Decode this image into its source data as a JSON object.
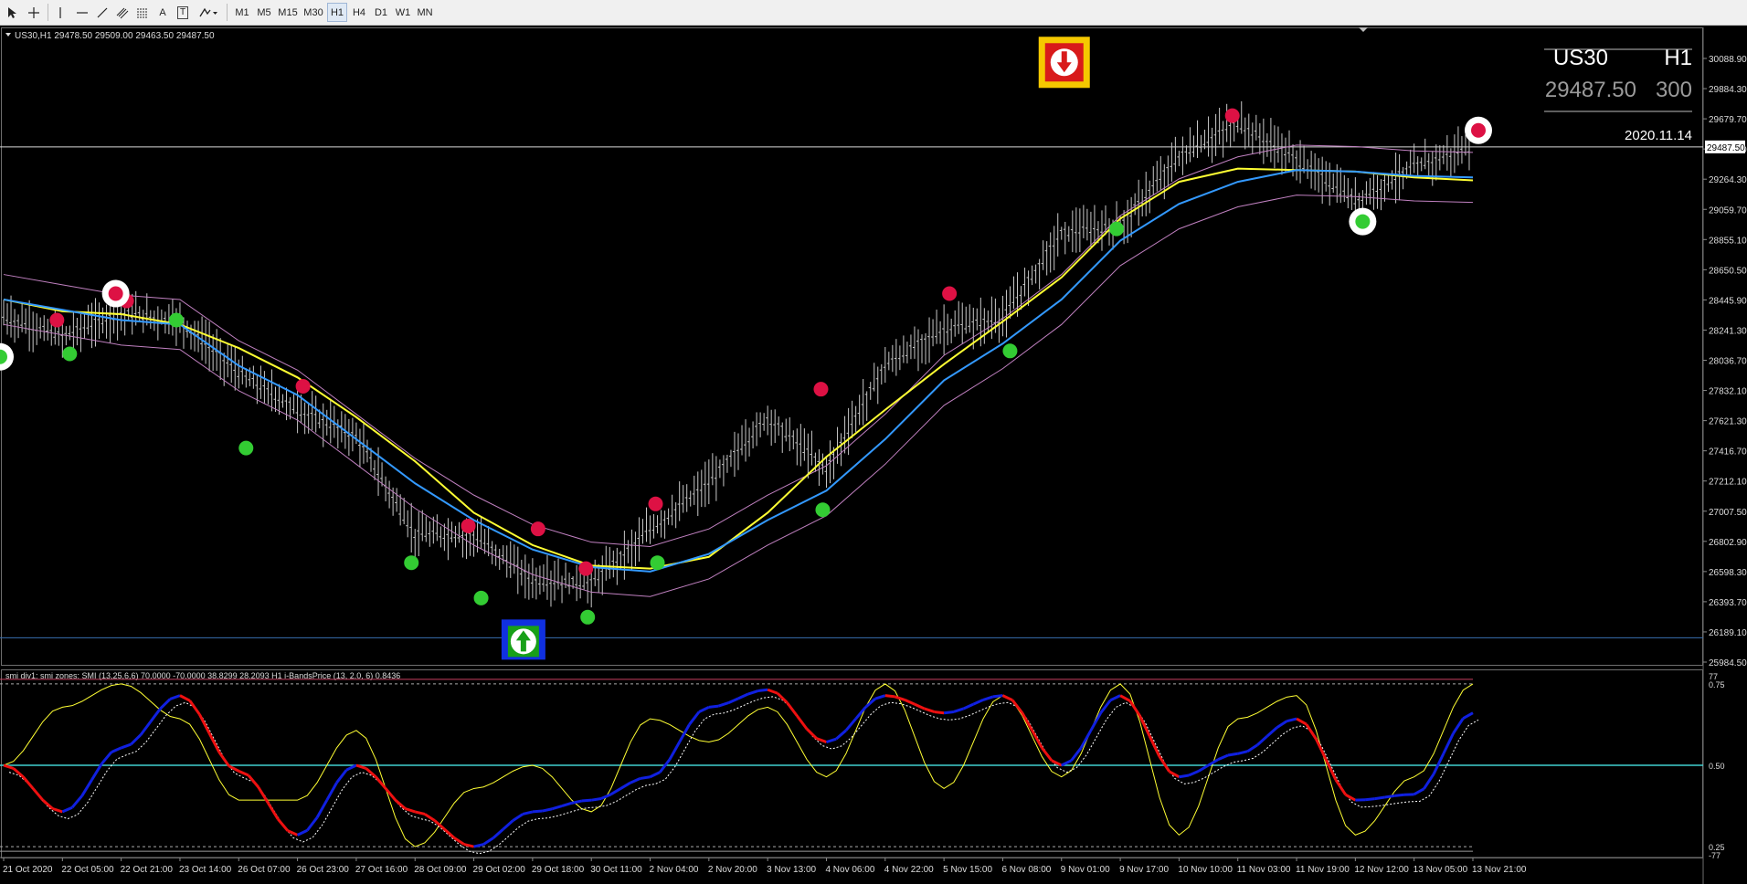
{
  "toolbar": {
    "icons": [
      "cursor-icon",
      "crosshair-icon",
      "vertical-line-icon",
      "horizontal-line-icon",
      "trendline-icon",
      "channel-icon",
      "fibonacci-icon",
      "text-icon",
      "label-icon",
      "shapes-dropdown-icon"
    ],
    "text_tool": "A",
    "label_tool": "T",
    "timeframes": [
      "M1",
      "M5",
      "M15",
      "M30",
      "H1",
      "H4",
      "D1",
      "W1",
      "MN"
    ],
    "active_timeframe": "H1"
  },
  "chart": {
    "header": "US30,H1  29478.50 29509.00 29463.50 29487.50",
    "symbol": "US30",
    "timeframe": "H1",
    "price": "29487.50",
    "spread": "300",
    "date": "2020.11.14",
    "current_price_label": "29487.50",
    "price_ticks": [
      "30088.90",
      "29884.30",
      "29679.70",
      "29474.20",
      "29264.30",
      "29059.70",
      "28855.10",
      "28650.50",
      "28445.90",
      "28241.30",
      "28036.70",
      "27832.10",
      "27621.30",
      "27416.70",
      "27212.10",
      "27007.50",
      "26802.90",
      "26598.30",
      "26393.70",
      "26189.10",
      "25984.50"
    ],
    "colors": {
      "ma_yellow": "#ffff33",
      "ma_blue": "#3399ff",
      "bands": "#c080c0",
      "buy": "#33cc33",
      "sell": "#dd1144",
      "candles": "#c8c8c8"
    }
  },
  "chart_data": [
    {
      "type": "line",
      "title": "US30,H1",
      "ylim": [
        25984.5,
        30088.9
      ],
      "x": [
        "21 Oct 2020",
        "22 Oct 05:00",
        "22 Oct 21:00",
        "23 Oct 14:00",
        "26 Oct 07:00",
        "26 Oct 23:00",
        "27 Oct 16:00",
        "28 Oct 09:00",
        "29 Oct 02:00",
        "29 Oct 18:00",
        "30 Oct 11:00",
        "2 Nov 04:00",
        "2 Nov 20:00",
        "3 Nov 13:00",
        "4 Nov 06:00",
        "4 Nov 22:00",
        "5 Nov 15:00",
        "6 Nov 08:00",
        "9 Nov 01:00",
        "9 Nov 17:00",
        "10 Nov 10:00",
        "11 Nov 03:00",
        "11 Nov 19:00",
        "12 Nov 12:00",
        "13 Nov 05:00",
        "13 Nov 21:00"
      ],
      "series": [
        {
          "values": [
            28330,
            28200,
            28360,
            28300,
            27950,
            27700,
            27520,
            26850,
            26850,
            26540,
            26520,
            26880,
            27200,
            27650,
            27300,
            28000,
            28250,
            28320,
            28900,
            28950,
            29420,
            29650,
            29400,
            29120,
            29350,
            29487.5
          ]
        },
        {
          "values": [
            28450,
            28370,
            28350,
            28280,
            28120,
            27920,
            27650,
            27350,
            27000,
            26780,
            26640,
            26620,
            26700,
            27000,
            27380,
            27700,
            28010,
            28300,
            28600,
            29000,
            29250,
            29340,
            29330,
            29320,
            29280,
            29260
          ]
        },
        {
          "values": [
            28450,
            28380,
            28310,
            28280,
            28000,
            27800,
            27500,
            27200,
            26950,
            26750,
            26630,
            26600,
            26720,
            26950,
            27150,
            27500,
            27900,
            28150,
            28450,
            28850,
            29100,
            29250,
            29330,
            29320,
            29290,
            29280
          ]
        }
      ],
      "signals_buy": [
        {
          "x": "21 Oct 2020",
          "y": 28060
        },
        {
          "x": "22 Oct 05:00",
          "y": 28080
        },
        {
          "x": "23 Oct 14:00",
          "y": 28310
        },
        {
          "x": "26 Oct 07:00",
          "y": 27440
        },
        {
          "x": "28 Oct 09:00",
          "y": 26660
        },
        {
          "x": "29 Oct 02:00",
          "y": 26420
        },
        {
          "x": "30 Oct 11:00",
          "y": 26290
        },
        {
          "x": "2 Nov 04:00",
          "y": 26660
        },
        {
          "x": "4 Nov 06:00",
          "y": 27020
        },
        {
          "x": "6 Nov 08:00",
          "y": 28100
        },
        {
          "x": "9 Nov 17:00",
          "y": 28930
        },
        {
          "x": "12 Nov 12:00",
          "y": 28980
        }
      ],
      "signals_sell": [
        {
          "x": "22 Oct 05:00",
          "y": 28310
        },
        {
          "x": "22 Oct 21:00",
          "y": 28440
        },
        {
          "x": "22 Oct 21:00",
          "y": 28490
        },
        {
          "x": "26 Oct 23:00",
          "y": 27860
        },
        {
          "x": "29 Oct 02:00",
          "y": 26910
        },
        {
          "x": "29 Oct 18:00",
          "y": 26890
        },
        {
          "x": "30 Oct 11:00",
          "y": 26620
        },
        {
          "x": "2 Nov 04:00",
          "y": 27060
        },
        {
          "x": "4 Nov 06:00",
          "y": 27840
        },
        {
          "x": "5 Nov 15:00",
          "y": 28490
        },
        {
          "x": "11 Nov 03:00",
          "y": 29700
        },
        {
          "x": "13 Nov 21:00",
          "y": 29600
        }
      ],
      "arrow_up": {
        "x": "29 Oct 18:00",
        "y": 26150
      },
      "arrow_down": {
        "x": "9 Nov 01:00",
        "y": 30050
      }
    },
    {
      "type": "line",
      "title": "smi div1: smi zones: SMI (13,25,6,6) 70.0000 -70.0000 38.8299 28.2093  H1 i-BandsPrice (13, 2.0, 6) 0.8436",
      "ylim": [
        -77,
        77
      ],
      "tick_labels": [
        "77",
        "0.75",
        "0.50",
        "0.25",
        "-77"
      ],
      "levels": [
        70,
        0,
        -70
      ],
      "series": [
        {
          "values": [
            0,
            -40,
            15,
            60,
            -5,
            -60,
            0,
            -40,
            -70,
            -40,
            -30,
            -10,
            50,
            65,
            20,
            60,
            45,
            60,
            0,
            60,
            -10,
            10,
            40,
            -30,
            -25,
            45
          ]
        },
        {
          "values": [
            0,
            50,
            70,
            40,
            -30,
            -30,
            30,
            -70,
            -20,
            0,
            -40,
            40,
            20,
            50,
            -10,
            70,
            -20,
            60,
            -10,
            70,
            -60,
            40,
            60,
            -60,
            -10,
            70
          ]
        }
      ]
    }
  ]
}
